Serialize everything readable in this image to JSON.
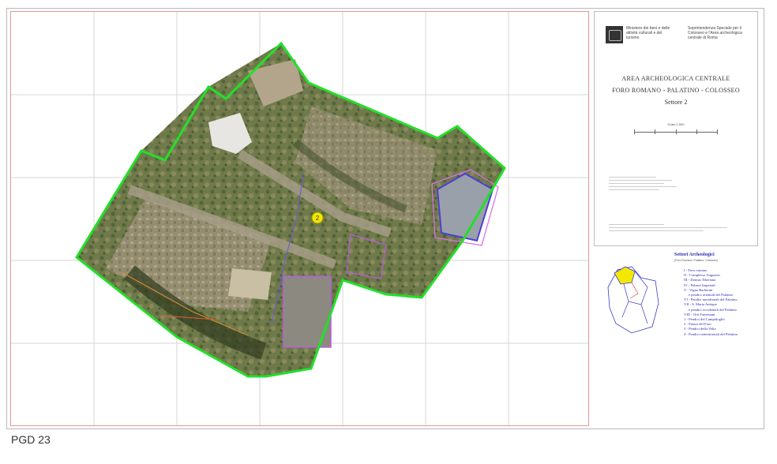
{
  "page_label": "PGD 23",
  "header": {
    "ministry_text": "Ministero dei beni e delle attività culturali e del turismo",
    "soprintendenza_text": "Soprintendenza Speciale per il Colosseo e l'Area archeologica centrale di Roma"
  },
  "title_block": {
    "line1": "AREA ARCHEOLOGICA CENTRALE",
    "line2": "FORO ROMANO - PALATINO - COLOSSEO",
    "line3": "Settore 2",
    "scale_label": "Scala 1:500"
  },
  "sectors_legend": {
    "title": "Settori Archeologici",
    "subtitle": "(Foro Romano, Palatino, Colosseo)",
    "items": [
      "I - Foro romano",
      "II - Complesso Augusteo",
      "III - Domus Tiberiana",
      "IV - Palazzi Imperiali",
      "V - Vigna Barberini",
      "e pendici orientali del Palatino",
      "VI - Pendici meridionali del Palatino",
      "VII - S. Maria Antiqua",
      "e pendici occidentali del Palatino",
      "VIII - Orti Farnesiani",
      "1 - Pendici del Campidoglio",
      "2 - Piazza del Foro",
      "3 - Pendici della Velia",
      "4 - Pendici settentrionali del Palatino"
    ]
  },
  "map": {
    "highlight_marker": "2",
    "boundary_color": "#22e02a",
    "grid_color": "#d6d6d6",
    "frame_color": "#e39a9a",
    "legend_text_color": "#2a2ab0",
    "inset_highlight_color": "#f5e800"
  }
}
